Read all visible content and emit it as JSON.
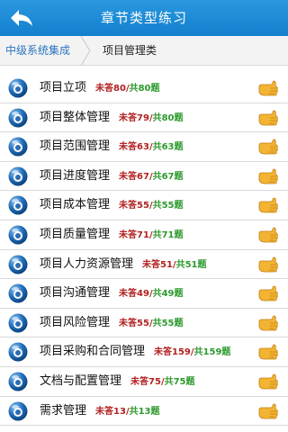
{
  "header": {
    "title": "章节类型练习",
    "back_icon": "back-arrow-icon"
  },
  "breadcrumb": {
    "parent": "中级系统集成",
    "current": "项目管理类"
  },
  "colors": {
    "header": "#1a8ad8",
    "unanswered": "#b22222",
    "total": "#2e9a2e"
  },
  "items": [
    {
      "name": "项目立项",
      "unanswered": "未答80",
      "slash": "/",
      "total": "共80题"
    },
    {
      "name": "项目整体管理",
      "unanswered": "未答79",
      "slash": "/",
      "total": "共80题"
    },
    {
      "name": "项目范围管理",
      "unanswered": "未答63",
      "slash": "/",
      "total": "共63题"
    },
    {
      "name": "项目进度管理",
      "unanswered": "未答67",
      "slash": "/",
      "total": "共67题"
    },
    {
      "name": "项目成本管理",
      "unanswered": "未答55",
      "slash": "/",
      "total": "共55题"
    },
    {
      "name": "项目质量管理",
      "unanswered": "未答71",
      "slash": "/",
      "total": "共71题"
    },
    {
      "name": "项目人力资源管理",
      "unanswered": "未答51",
      "slash": "/",
      "total": "共51题"
    },
    {
      "name": "项目沟通管理",
      "unanswered": "未答49",
      "slash": "/",
      "total": "共49题"
    },
    {
      "name": "项目风险管理",
      "unanswered": "未答55",
      "slash": "/",
      "total": "共55题"
    },
    {
      "name": "项目采购和合同管理",
      "unanswered": "未答159",
      "slash": "/",
      "total": "共159题"
    },
    {
      "name": "文档与配置管理",
      "unanswered": "未答75",
      "slash": "/",
      "total": "共75题"
    },
    {
      "name": "需求管理",
      "unanswered": "未答13",
      "slash": "/",
      "total": "共13题"
    }
  ]
}
